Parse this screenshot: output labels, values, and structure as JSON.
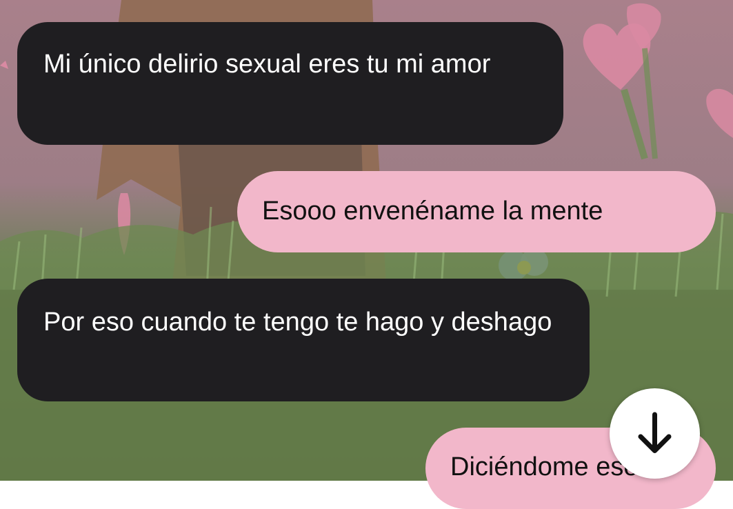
{
  "conversation": {
    "messages": [
      {
        "direction": "received",
        "text": "Mi único delirio sexual eres tu mi amor"
      },
      {
        "direction": "sent",
        "text": "Esooo envenéname la mente"
      },
      {
        "direction": "received",
        "text": "Por eso cuando te tengo te hago y deshago"
      },
      {
        "direction": "sent",
        "text": "Diciéndome eso"
      }
    ]
  },
  "controls": {
    "scroll_to_bottom_icon": "arrow-down-icon"
  },
  "colors": {
    "received_bubble": "#1f1e21",
    "received_text": "#ffffff",
    "sent_bubble": "#f2b7ca",
    "sent_text": "#111111",
    "scroll_button": "#ffffff"
  }
}
